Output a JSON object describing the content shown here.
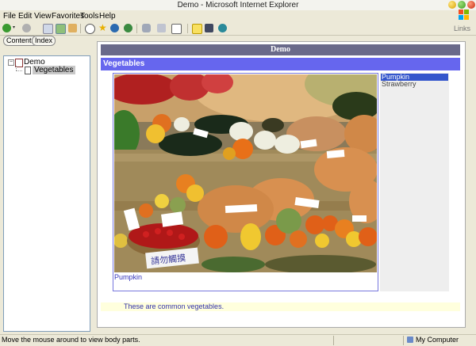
{
  "window": {
    "title": "Demo - Microsoft Internet Explorer"
  },
  "menu": [
    "File",
    "Edit",
    "View",
    "Favorites",
    "Tools",
    "Help"
  ],
  "toolbar": {
    "links_label": "Links"
  },
  "left": {
    "tabs": [
      "Contents",
      "Index"
    ],
    "tree": {
      "root": "Demo",
      "child": "Vegetables"
    }
  },
  "content": {
    "banner": "Demo",
    "heading": "Vegetables",
    "caption": "Pumpkin",
    "list": [
      "Pumpkin",
      "Strawberry"
    ],
    "selected": "Pumpkin",
    "note": "These are common vegetables.",
    "photo_sign": "請勿觸摸"
  },
  "status": {
    "message": "Move the mouse around to view body parts.",
    "zone": "My Computer"
  }
}
